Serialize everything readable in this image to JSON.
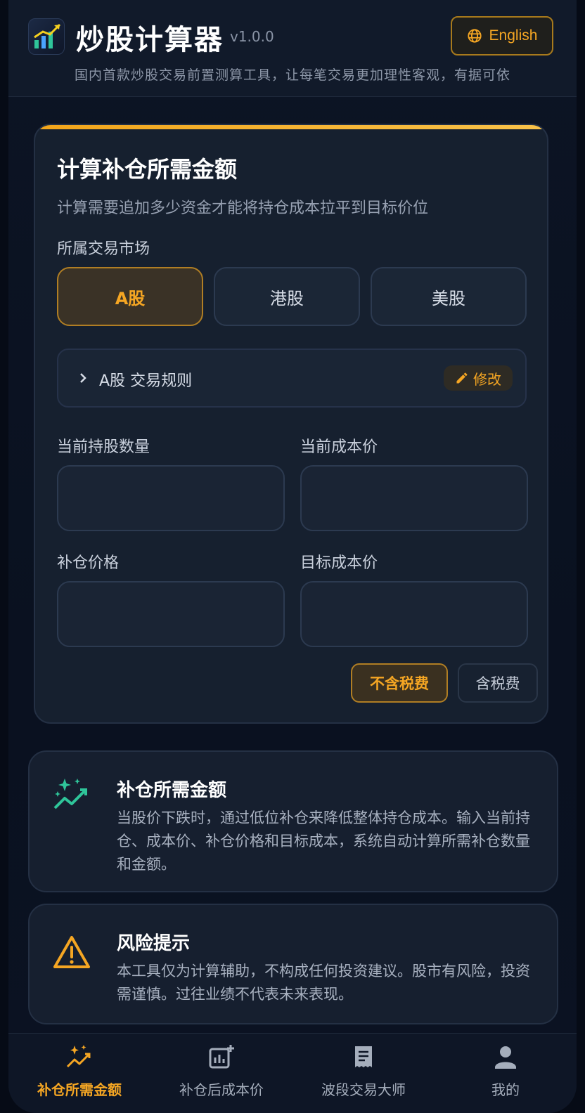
{
  "header": {
    "app_title": "炒股计算器",
    "version": "v1.0.0",
    "language_button": "English",
    "subtitle": "国内首款炒股交易前置测算工具，让每笔交易更加理性客观，有据可依"
  },
  "calculator": {
    "title": "计算补仓所需金额",
    "description": "计算需要追加多少资金才能将持仓成本拉平到目标价位",
    "market_label": "所属交易市场",
    "markets": [
      {
        "label": "A股",
        "active": true
      },
      {
        "label": "港股",
        "active": false
      },
      {
        "label": "美股",
        "active": false
      }
    ],
    "rules": {
      "market": "A股",
      "label": "交易规则",
      "edit_label": "修改"
    },
    "fields": {
      "current_shares": {
        "label": "当前持股数量",
        "value": ""
      },
      "current_cost": {
        "label": "当前成本价",
        "value": ""
      },
      "add_price": {
        "label": "补仓价格",
        "value": ""
      },
      "target_cost": {
        "label": "目标成本价",
        "value": ""
      }
    },
    "tax_options": [
      {
        "label": "不含税费",
        "active": true
      },
      {
        "label": "含税费",
        "active": false
      }
    ]
  },
  "info": {
    "title": "补仓所需金额",
    "body": "当股价下跌时，通过低位补仓来降低整体持仓成本。输入当前持仓、成本价、补仓价格和目标成本，系统自动计算所需补仓数量和金额。",
    "icon": "sparkle-trend-icon"
  },
  "risk": {
    "title": "风险提示",
    "body": "本工具仅为计算辅助，不构成任何投资建议。股市有风险，投资需谨慎。过往业绩不代表未来表现。",
    "icon": "warning-icon"
  },
  "bottom_nav": [
    {
      "label": "补仓所需金额",
      "icon": "sparkle-trend-icon",
      "active": true
    },
    {
      "label": "补仓后成本价",
      "icon": "chart-plus-icon",
      "active": false
    },
    {
      "label": "波段交易大师",
      "icon": "receipt-icon",
      "active": false
    },
    {
      "label": "我的",
      "icon": "person-icon",
      "active": false
    }
  ],
  "colors": {
    "accent": "#f5a623",
    "background": "#0a1120",
    "card": "#16202f",
    "success_icon": "#2fc59a"
  }
}
